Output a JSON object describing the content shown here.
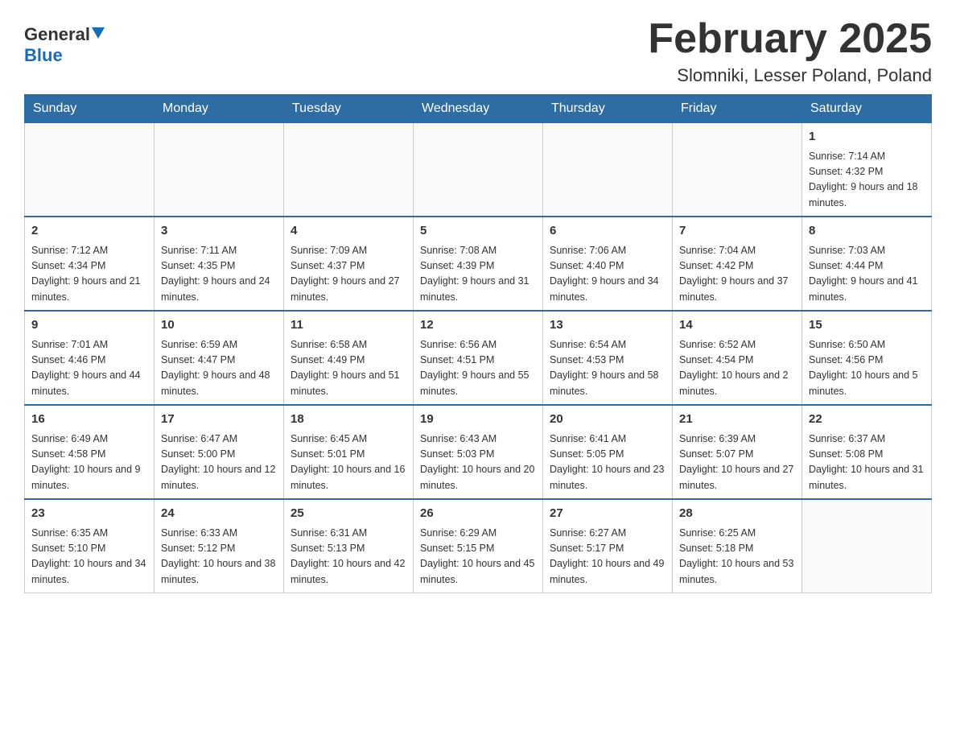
{
  "header": {
    "logo_general": "General",
    "logo_blue": "Blue",
    "month_year": "February 2025",
    "location": "Slomniki, Lesser Poland, Poland"
  },
  "weekdays": [
    "Sunday",
    "Monday",
    "Tuesday",
    "Wednesday",
    "Thursday",
    "Friday",
    "Saturday"
  ],
  "rows": [
    [
      {
        "day": "",
        "info": ""
      },
      {
        "day": "",
        "info": ""
      },
      {
        "day": "",
        "info": ""
      },
      {
        "day": "",
        "info": ""
      },
      {
        "day": "",
        "info": ""
      },
      {
        "day": "",
        "info": ""
      },
      {
        "day": "1",
        "info": "Sunrise: 7:14 AM\nSunset: 4:32 PM\nDaylight: 9 hours and 18 minutes."
      }
    ],
    [
      {
        "day": "2",
        "info": "Sunrise: 7:12 AM\nSunset: 4:34 PM\nDaylight: 9 hours and 21 minutes."
      },
      {
        "day": "3",
        "info": "Sunrise: 7:11 AM\nSunset: 4:35 PM\nDaylight: 9 hours and 24 minutes."
      },
      {
        "day": "4",
        "info": "Sunrise: 7:09 AM\nSunset: 4:37 PM\nDaylight: 9 hours and 27 minutes."
      },
      {
        "day": "5",
        "info": "Sunrise: 7:08 AM\nSunset: 4:39 PM\nDaylight: 9 hours and 31 minutes."
      },
      {
        "day": "6",
        "info": "Sunrise: 7:06 AM\nSunset: 4:40 PM\nDaylight: 9 hours and 34 minutes."
      },
      {
        "day": "7",
        "info": "Sunrise: 7:04 AM\nSunset: 4:42 PM\nDaylight: 9 hours and 37 minutes."
      },
      {
        "day": "8",
        "info": "Sunrise: 7:03 AM\nSunset: 4:44 PM\nDaylight: 9 hours and 41 minutes."
      }
    ],
    [
      {
        "day": "9",
        "info": "Sunrise: 7:01 AM\nSunset: 4:46 PM\nDaylight: 9 hours and 44 minutes."
      },
      {
        "day": "10",
        "info": "Sunrise: 6:59 AM\nSunset: 4:47 PM\nDaylight: 9 hours and 48 minutes."
      },
      {
        "day": "11",
        "info": "Sunrise: 6:58 AM\nSunset: 4:49 PM\nDaylight: 9 hours and 51 minutes."
      },
      {
        "day": "12",
        "info": "Sunrise: 6:56 AM\nSunset: 4:51 PM\nDaylight: 9 hours and 55 minutes."
      },
      {
        "day": "13",
        "info": "Sunrise: 6:54 AM\nSunset: 4:53 PM\nDaylight: 9 hours and 58 minutes."
      },
      {
        "day": "14",
        "info": "Sunrise: 6:52 AM\nSunset: 4:54 PM\nDaylight: 10 hours and 2 minutes."
      },
      {
        "day": "15",
        "info": "Sunrise: 6:50 AM\nSunset: 4:56 PM\nDaylight: 10 hours and 5 minutes."
      }
    ],
    [
      {
        "day": "16",
        "info": "Sunrise: 6:49 AM\nSunset: 4:58 PM\nDaylight: 10 hours and 9 minutes."
      },
      {
        "day": "17",
        "info": "Sunrise: 6:47 AM\nSunset: 5:00 PM\nDaylight: 10 hours and 12 minutes."
      },
      {
        "day": "18",
        "info": "Sunrise: 6:45 AM\nSunset: 5:01 PM\nDaylight: 10 hours and 16 minutes."
      },
      {
        "day": "19",
        "info": "Sunrise: 6:43 AM\nSunset: 5:03 PM\nDaylight: 10 hours and 20 minutes."
      },
      {
        "day": "20",
        "info": "Sunrise: 6:41 AM\nSunset: 5:05 PM\nDaylight: 10 hours and 23 minutes."
      },
      {
        "day": "21",
        "info": "Sunrise: 6:39 AM\nSunset: 5:07 PM\nDaylight: 10 hours and 27 minutes."
      },
      {
        "day": "22",
        "info": "Sunrise: 6:37 AM\nSunset: 5:08 PM\nDaylight: 10 hours and 31 minutes."
      }
    ],
    [
      {
        "day": "23",
        "info": "Sunrise: 6:35 AM\nSunset: 5:10 PM\nDaylight: 10 hours and 34 minutes."
      },
      {
        "day": "24",
        "info": "Sunrise: 6:33 AM\nSunset: 5:12 PM\nDaylight: 10 hours and 38 minutes."
      },
      {
        "day": "25",
        "info": "Sunrise: 6:31 AM\nSunset: 5:13 PM\nDaylight: 10 hours and 42 minutes."
      },
      {
        "day": "26",
        "info": "Sunrise: 6:29 AM\nSunset: 5:15 PM\nDaylight: 10 hours and 45 minutes."
      },
      {
        "day": "27",
        "info": "Sunrise: 6:27 AM\nSunset: 5:17 PM\nDaylight: 10 hours and 49 minutes."
      },
      {
        "day": "28",
        "info": "Sunrise: 6:25 AM\nSunset: 5:18 PM\nDaylight: 10 hours and 53 minutes."
      },
      {
        "day": "",
        "info": ""
      }
    ]
  ]
}
